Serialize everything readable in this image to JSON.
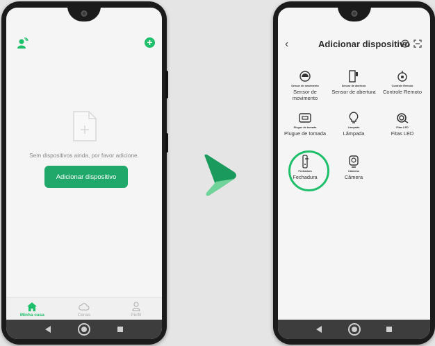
{
  "left_phone": {
    "empty_message": "Sem dispositivos ainda, por favor adicione.",
    "add_button": "Adicionar dispositivo",
    "tabs": [
      {
        "label": "Minha casa",
        "icon": "home-icon",
        "active": true
      },
      {
        "label": "Cenas",
        "icon": "cloud-icon",
        "active": false
      },
      {
        "label": "Perfil",
        "icon": "profile-icon",
        "active": false
      }
    ]
  },
  "right_phone": {
    "title": "Adicionar dispositivo",
    "devices": [
      {
        "tiny": "Sensor de movimento",
        "label": "Sensor de movimento",
        "icon": "motion-sensor-icon"
      },
      {
        "tiny": "Sensor de abertura",
        "label": "Sensor de abertura",
        "icon": "door-sensor-icon"
      },
      {
        "tiny": "Controle Remoto",
        "label": "Controle Remoto",
        "icon": "remote-icon"
      },
      {
        "tiny": "Plugue de tomada",
        "label": "Plugue de tomada",
        "icon": "plug-icon"
      },
      {
        "tiny": "Lâmpada",
        "label": "Lâmpada",
        "icon": "bulb-icon"
      },
      {
        "tiny": "Fitas LED",
        "label": "Fitas LED",
        "icon": "led-strip-icon"
      },
      {
        "tiny": "Fechadura",
        "label": "Fechadura",
        "icon": "lock-icon"
      },
      {
        "tiny": "Câmeras",
        "label": "Câmera",
        "icon": "camera-icon"
      }
    ]
  },
  "colors": {
    "accent": "#1ebf6a",
    "button": "#1fa86a",
    "chevron_dark": "#1a9a5c",
    "chevron_light": "#6fd39a"
  }
}
